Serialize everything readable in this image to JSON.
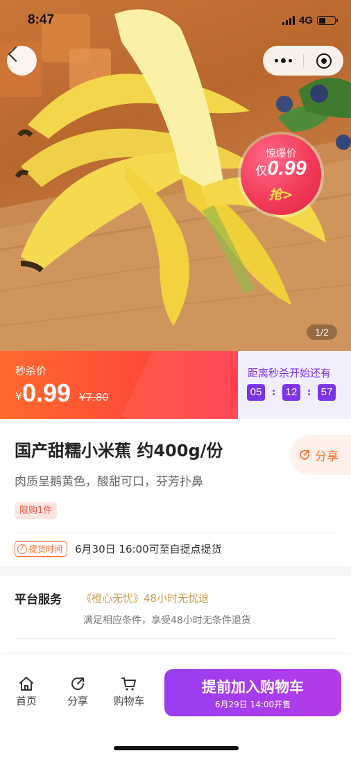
{
  "status_bar": {
    "time": "8:47",
    "network": "4G"
  },
  "hero": {
    "badge": {
      "top_label": "惊爆价",
      "prefix": "仅",
      "price": "0.99",
      "action": "抢>"
    },
    "page_indicator": "1/2"
  },
  "flash_sale": {
    "label": "秒杀价",
    "currency": "¥",
    "price": "0.99",
    "original_price": "¥7.80",
    "countdown_title": "距离秒杀开始还有",
    "countdown": {
      "hours": "05",
      "minutes": "12",
      "seconds": "57"
    },
    "colon": ":"
  },
  "product": {
    "title": "国产甜糯小米蕉 约400g/份",
    "subtitle": "肉质呈鹅黄色，酸甜可口，芬芳扑鼻",
    "limit_tag": "限购1件",
    "share_label": "分享"
  },
  "pickup": {
    "tag": "提货时间",
    "text": "6月30日 16:00可至自提点提货"
  },
  "service": {
    "label": "平台服务",
    "name": "《橙心无忧》48小时无忧退",
    "desc": "满足相应条件，享受48小时无条件退货"
  },
  "bottom_bar": {
    "nav": [
      {
        "label": "首页",
        "icon": "home-icon"
      },
      {
        "label": "分享",
        "icon": "share-icon"
      },
      {
        "label": "购物车",
        "icon": "cart-icon"
      }
    ],
    "cart_button": {
      "main": "提前加入购物车",
      "sub": "6月29日 14:00开售"
    }
  },
  "colors": {
    "accent_orange": "#ff6a2b",
    "accent_red": "#ff3c4c",
    "accent_purple": "#7b35e8",
    "button_purple": "#a83cec",
    "gold": "#c99a4e"
  }
}
